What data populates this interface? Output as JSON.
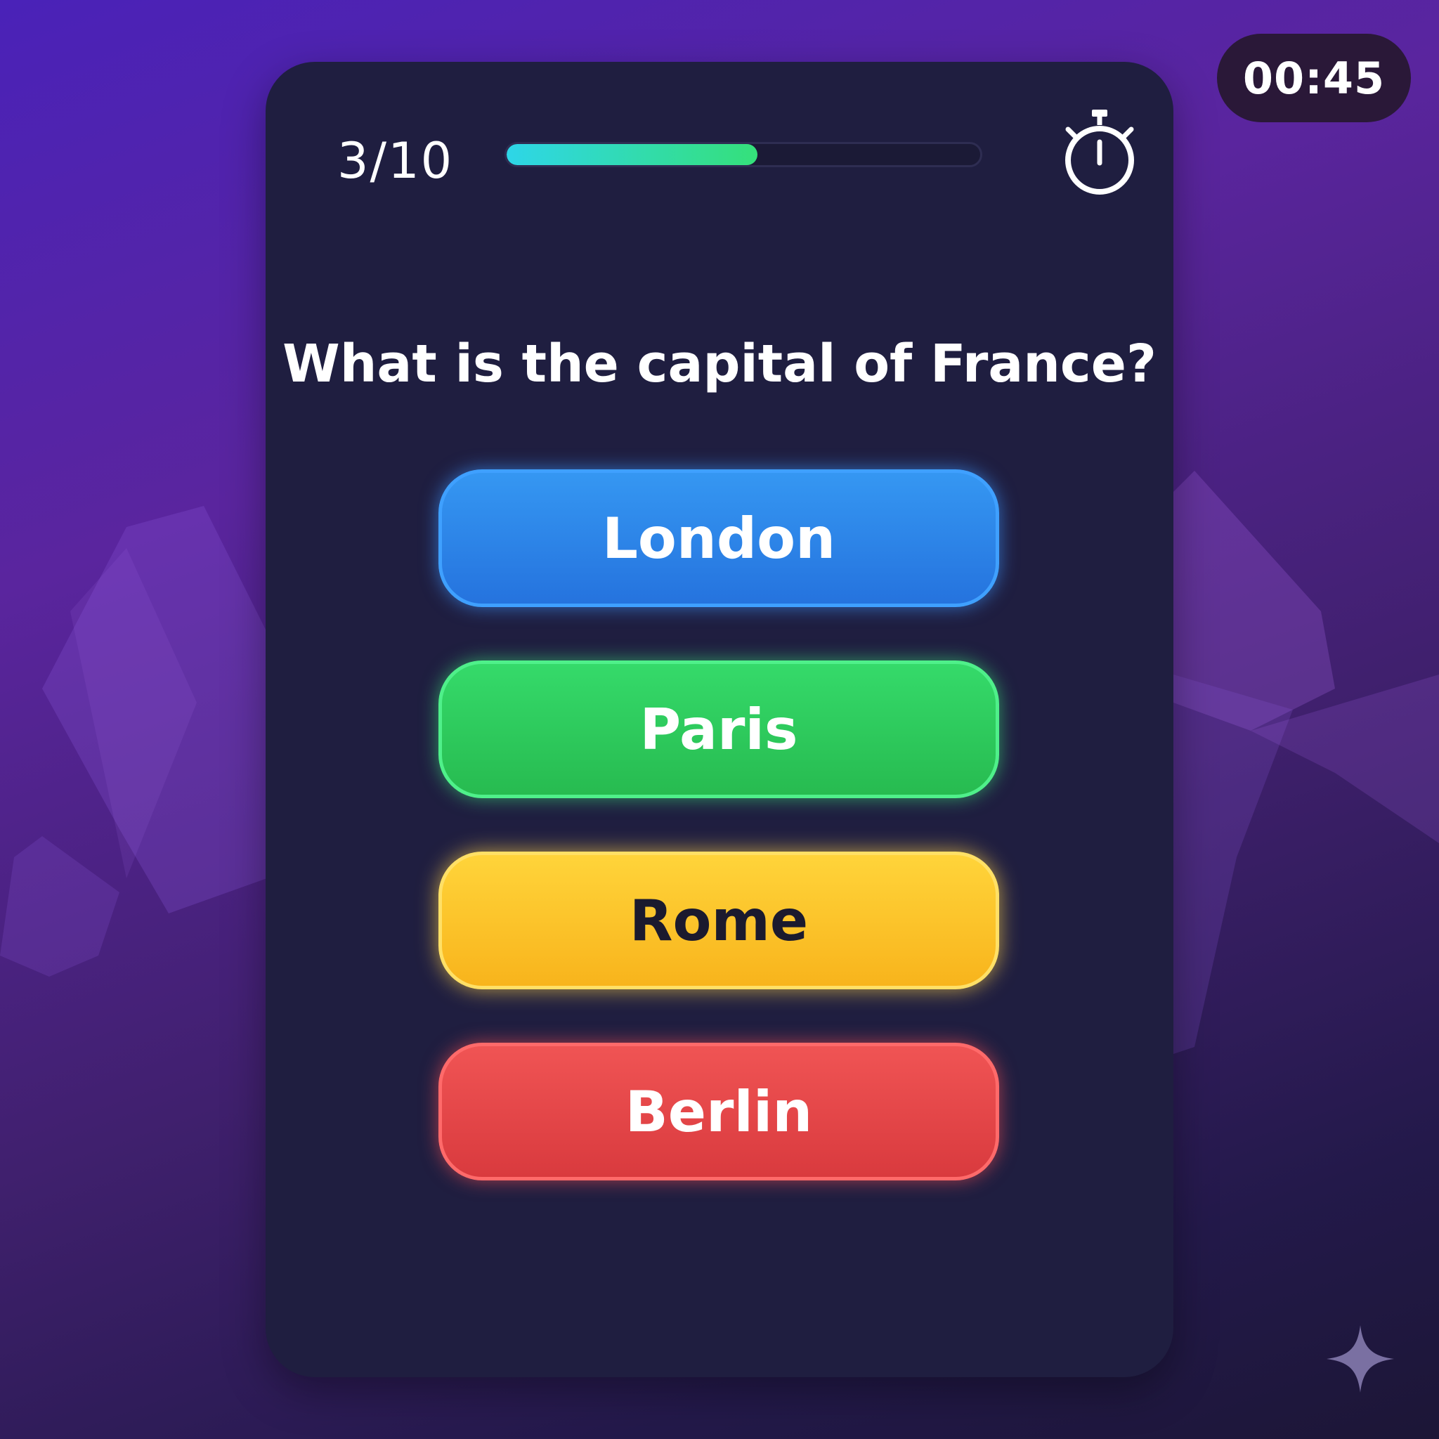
{
  "timer": {
    "display": "00:45",
    "icon": "stopwatch-icon"
  },
  "progress": {
    "label": "3/10",
    "current": 3,
    "total": 10,
    "fill_fraction": 0.53,
    "fill_gradient": [
      "#2ed6e8",
      "#35e07a"
    ]
  },
  "question": {
    "text": "What is the capital of France?"
  },
  "answers": [
    {
      "label": "London",
      "color": "#2f86ec"
    },
    {
      "label": "Paris",
      "color": "#2ccb5c"
    },
    {
      "label": "Rome",
      "color": "#fcc52b"
    },
    {
      "label": "Berlin",
      "color": "#e64648"
    }
  ],
  "colors": {
    "background": "#4a22b8",
    "card": "#1f1e40",
    "timer_pill": "#2a1838"
  },
  "decor": {
    "sparkle_icon": "sparkle-icon"
  }
}
